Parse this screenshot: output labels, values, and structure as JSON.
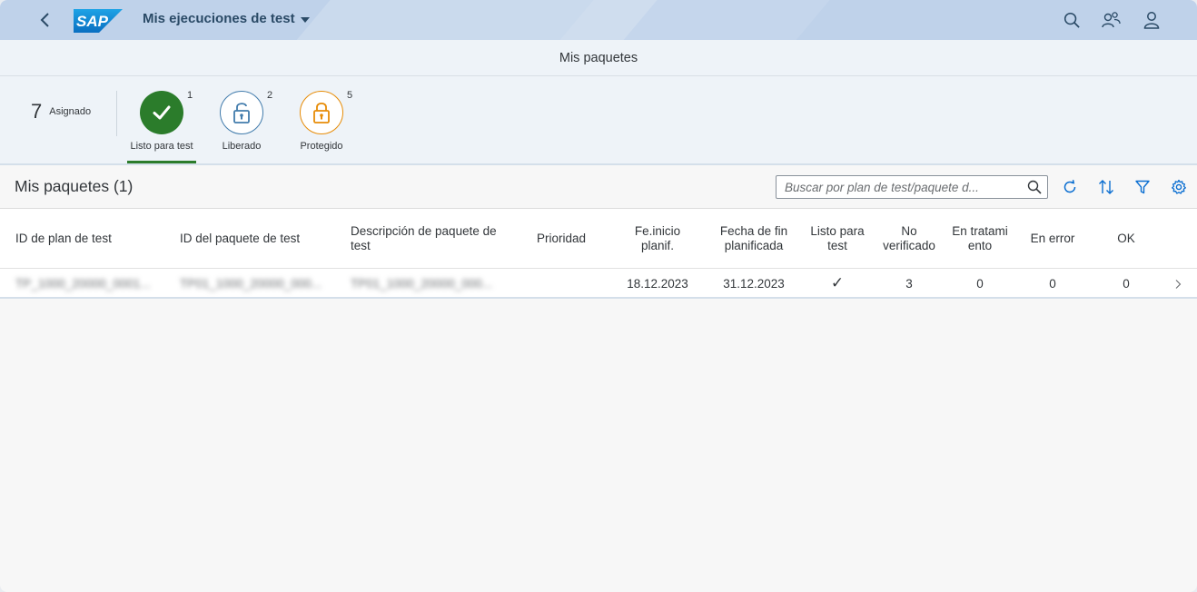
{
  "shell": {
    "logo_text": "SAP",
    "app_title": "Mis ejecuciones de test"
  },
  "page": {
    "title": "Mis paquetes"
  },
  "tabbar": {
    "total_count": "7",
    "total_label": "Asignado",
    "tabs": [
      {
        "label": "Listo para test",
        "count": "1",
        "color": "#2b7c2b",
        "selected": true
      },
      {
        "label": "Liberado",
        "count": "2",
        "color": "#427cac",
        "selected": false
      },
      {
        "label": "Protegido",
        "count": "5",
        "color": "#e78c07",
        "selected": false
      }
    ]
  },
  "table": {
    "title": "Mis paquetes (1)",
    "search_placeholder": "Buscar por plan de test/paquete d...",
    "columns": {
      "plan_id": "ID de plan de test",
      "package_id": "ID del paquete de test",
      "description": "Descripción de paquete de test",
      "priority": "Prioridad",
      "start_date": "Fe.inicio planif.",
      "end_date": "Fecha de fin planificada",
      "ready": "Listo para test",
      "not_verified": "No verificado",
      "in_process": "En tratamiento",
      "in_error": "En error",
      "ok": "OK"
    },
    "rows": [
      {
        "plan_id": "TP_1000_20000_0001...",
        "package_id": "TP01_1000_20000_000...",
        "description": "TP01_1000_20000_000...",
        "priority": "",
        "start_date": "18.12.2023",
        "end_date": "31.12.2023",
        "ready_mark": "✓",
        "not_verified": "3",
        "in_process": "0",
        "in_error": "0",
        "ok": "0"
      }
    ]
  }
}
